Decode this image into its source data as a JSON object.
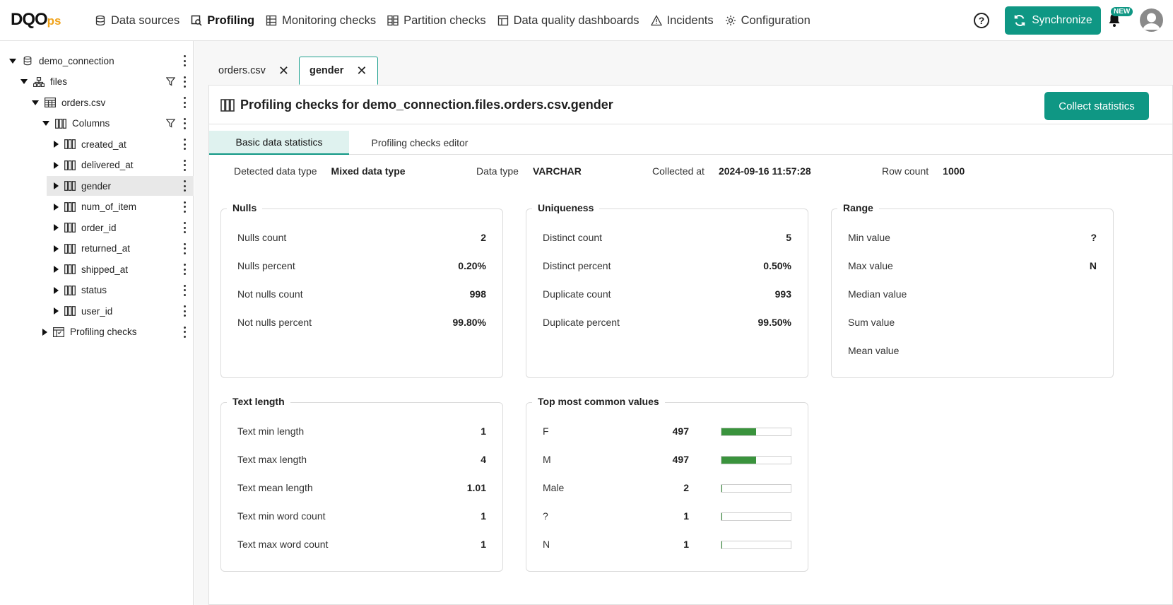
{
  "app": {
    "logo_main": "DQO",
    "logo_suffix": "ps"
  },
  "nav": [
    {
      "label": "Data sources",
      "icon": "database-icon",
      "active": false
    },
    {
      "label": "Profiling",
      "icon": "profiling-icon",
      "active": true
    },
    {
      "label": "Monitoring checks",
      "icon": "monitoring-icon",
      "active": false
    },
    {
      "label": "Partition checks",
      "icon": "partition-icon",
      "active": false
    },
    {
      "label": "Data quality dashboards",
      "icon": "dashboard-icon",
      "active": false
    },
    {
      "label": "Incidents",
      "icon": "warning-icon",
      "active": false
    },
    {
      "label": "Configuration",
      "icon": "gear-icon",
      "active": false
    }
  ],
  "header": {
    "help": "?",
    "synchronize_label": "Synchronize",
    "new_badge": "NEW"
  },
  "tree": [
    {
      "label": "demo_connection",
      "level": 0,
      "caret": "down",
      "icon": "database-icon",
      "filter": false,
      "selected": false
    },
    {
      "label": "files",
      "level": 1,
      "caret": "down",
      "icon": "schema-icon",
      "filter": true,
      "selected": false
    },
    {
      "label": "orders.csv",
      "level": 2,
      "caret": "down",
      "icon": "table-icon",
      "filter": false,
      "selected": false
    },
    {
      "label": "Columns",
      "level": 3,
      "caret": "down",
      "icon": "columns-icon",
      "filter": true,
      "selected": false
    },
    {
      "label": "created_at",
      "level": 4,
      "caret": "right",
      "icon": "column-icon",
      "filter": false,
      "selected": false
    },
    {
      "label": "delivered_at",
      "level": 4,
      "caret": "right",
      "icon": "column-icon",
      "filter": false,
      "selected": false
    },
    {
      "label": "gender",
      "level": 4,
      "caret": "right",
      "icon": "column-icon",
      "filter": false,
      "selected": true
    },
    {
      "label": "num_of_item",
      "level": 4,
      "caret": "right",
      "icon": "column-icon",
      "filter": false,
      "selected": false
    },
    {
      "label": "order_id",
      "level": 4,
      "caret": "right",
      "icon": "column-icon",
      "filter": false,
      "selected": false
    },
    {
      "label": "returned_at",
      "level": 4,
      "caret": "right",
      "icon": "column-icon",
      "filter": false,
      "selected": false
    },
    {
      "label": "shipped_at",
      "level": 4,
      "caret": "right",
      "icon": "column-icon",
      "filter": false,
      "selected": false
    },
    {
      "label": "status",
      "level": 4,
      "caret": "right",
      "icon": "column-icon",
      "filter": false,
      "selected": false
    },
    {
      "label": "user_id",
      "level": 4,
      "caret": "right",
      "icon": "column-icon",
      "filter": false,
      "selected": false
    },
    {
      "label": "Profiling checks",
      "level": 3,
      "caret": "right",
      "icon": "checks-table-icon",
      "filter": false,
      "selected": false
    }
  ],
  "tabs": [
    {
      "label": "orders.csv",
      "active": false
    },
    {
      "label": "gender",
      "active": true
    }
  ],
  "panel": {
    "title": "Profiling checks for demo_connection.files.orders.csv.gender",
    "collect_label": "Collect statistics",
    "subtabs": [
      {
        "label": "Basic data statistics",
        "active": true
      },
      {
        "label": "Profiling checks editor",
        "active": false
      }
    ]
  },
  "summary": [
    {
      "label": "Detected data type",
      "value": "Mixed data type"
    },
    {
      "label": "Data type",
      "value": "VARCHAR"
    },
    {
      "label": "Collected at",
      "value": "2024-09-16 11:57:28"
    },
    {
      "label": "Row count",
      "value": "1000"
    }
  ],
  "cards": {
    "nulls": {
      "title": "Nulls",
      "rows": [
        {
          "k": "Nulls count",
          "v": "2"
        },
        {
          "k": "Nulls percent",
          "v": "0.20%"
        },
        {
          "k": "Not nulls count",
          "v": "998"
        },
        {
          "k": "Not nulls percent",
          "v": "99.80%"
        }
      ]
    },
    "uniqueness": {
      "title": "Uniqueness",
      "rows": [
        {
          "k": "Distinct count",
          "v": "5"
        },
        {
          "k": "Distinct percent",
          "v": "0.50%"
        },
        {
          "k": "Duplicate count",
          "v": "993"
        },
        {
          "k": "Duplicate percent",
          "v": "99.50%"
        }
      ]
    },
    "range": {
      "title": "Range",
      "rows": [
        {
          "k": "Min value",
          "v": "?"
        },
        {
          "k": "Max value",
          "v": "N"
        },
        {
          "k": "Median value",
          "v": ""
        },
        {
          "k": "Sum value",
          "v": ""
        },
        {
          "k": "Mean value",
          "v": ""
        }
      ]
    },
    "text_length": {
      "title": "Text length",
      "rows": [
        {
          "k": "Text min length",
          "v": "1"
        },
        {
          "k": "Text max length",
          "v": "4"
        },
        {
          "k": "Text mean length",
          "v": "1.01"
        },
        {
          "k": "Text min word count",
          "v": "1"
        },
        {
          "k": "Text max word count",
          "v": "1"
        }
      ]
    },
    "top_values": {
      "title": "Top most common values",
      "rows": [
        {
          "k": "F",
          "v": "497",
          "fraction": 0.497
        },
        {
          "k": "M",
          "v": "497",
          "fraction": 0.497
        },
        {
          "k": "Male",
          "v": "2",
          "fraction": 0.002
        },
        {
          "k": "?",
          "v": "1",
          "fraction": 0.001
        },
        {
          "k": "N",
          "v": "1",
          "fraction": 0.001
        }
      ]
    }
  },
  "colors": {
    "accent": "#0f9784",
    "bar_fill": "#3a933d",
    "selected_row": "#e8e8e8",
    "logo_ps": "#f0a21a"
  }
}
